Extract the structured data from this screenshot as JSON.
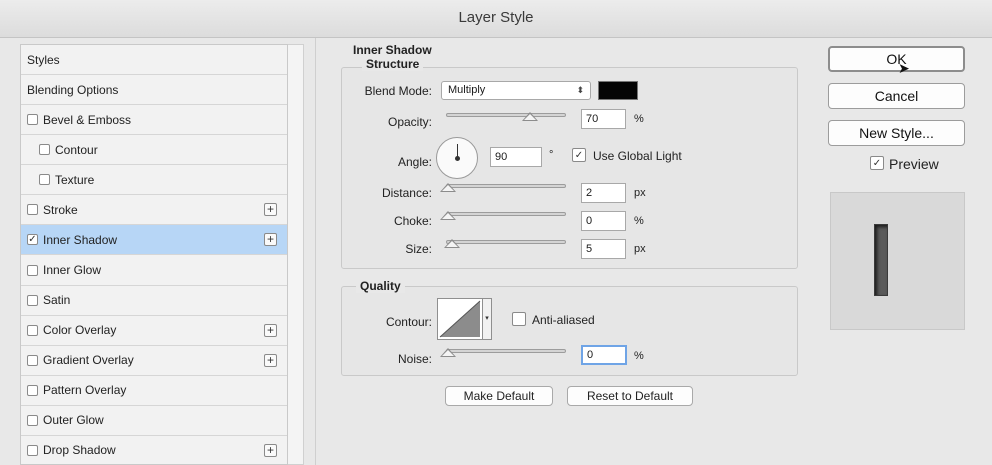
{
  "window": {
    "title": "Layer Style"
  },
  "styles_list": {
    "items": [
      {
        "label": "Styles",
        "checkbox": false,
        "checked": false,
        "plus": false,
        "indent": false,
        "selected": false
      },
      {
        "label": "Blending Options",
        "checkbox": false,
        "checked": false,
        "plus": false,
        "indent": false,
        "selected": false
      },
      {
        "label": "Bevel & Emboss",
        "checkbox": true,
        "checked": false,
        "plus": false,
        "indent": false,
        "selected": false
      },
      {
        "label": "Contour",
        "checkbox": true,
        "checked": false,
        "plus": false,
        "indent": true,
        "selected": false
      },
      {
        "label": "Texture",
        "checkbox": true,
        "checked": false,
        "plus": false,
        "indent": true,
        "selected": false
      },
      {
        "label": "Stroke",
        "checkbox": true,
        "checked": false,
        "plus": true,
        "indent": false,
        "selected": false
      },
      {
        "label": "Inner Shadow",
        "checkbox": true,
        "checked": true,
        "plus": true,
        "indent": false,
        "selected": true
      },
      {
        "label": "Inner Glow",
        "checkbox": true,
        "checked": false,
        "plus": false,
        "indent": false,
        "selected": false
      },
      {
        "label": "Satin",
        "checkbox": true,
        "checked": false,
        "plus": false,
        "indent": false,
        "selected": false
      },
      {
        "label": "Color Overlay",
        "checkbox": true,
        "checked": false,
        "plus": true,
        "indent": false,
        "selected": false
      },
      {
        "label": "Gradient Overlay",
        "checkbox": true,
        "checked": false,
        "plus": true,
        "indent": false,
        "selected": false
      },
      {
        "label": "Pattern Overlay",
        "checkbox": true,
        "checked": false,
        "plus": false,
        "indent": false,
        "selected": false
      },
      {
        "label": "Outer Glow",
        "checkbox": true,
        "checked": false,
        "plus": false,
        "indent": false,
        "selected": false
      },
      {
        "label": "Drop Shadow",
        "checkbox": true,
        "checked": false,
        "plus": true,
        "indent": false,
        "selected": false
      }
    ]
  },
  "inner_shadow": {
    "title": "Inner Shadow",
    "structure": {
      "title": "Structure",
      "blend_mode_label": "Blend Mode:",
      "blend_mode_value": "Multiply",
      "shadow_color": "#050505",
      "opacity_label": "Opacity:",
      "opacity_value": "70",
      "opacity_unit": "%",
      "opacity_level": 0.7,
      "angle_label": "Angle:",
      "angle_value": "90",
      "angle_unit": "°",
      "global_light_label": "Use Global Light",
      "global_light_checked": true,
      "distance_label": "Distance:",
      "distance_value": "2",
      "distance_unit": "px",
      "choke_label": "Choke:",
      "choke_value": "0",
      "choke_unit": "%",
      "size_label": "Size:",
      "size_value": "5",
      "size_unit": "px"
    },
    "quality": {
      "title": "Quality",
      "contour_label": "Contour:",
      "anti_aliased_label": "Anti-aliased",
      "anti_aliased_checked": false,
      "noise_label": "Noise:",
      "noise_value": "0",
      "noise_unit": "%"
    },
    "make_default_label": "Make Default",
    "reset_default_label": "Reset to Default"
  },
  "actions": {
    "ok_label": "OK",
    "cancel_label": "Cancel",
    "new_style_label": "New Style...",
    "preview_label": "Preview",
    "preview_checked": true
  }
}
